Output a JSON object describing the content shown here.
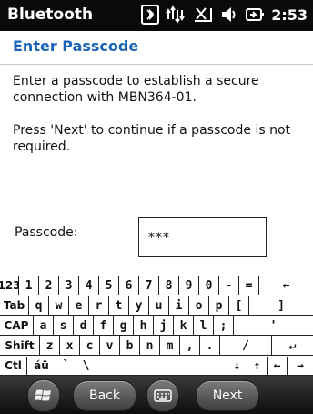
{
  "statusbar": {
    "title": "Bluetooth",
    "time": "2:53",
    "icons": [
      "bluetooth-icon",
      "connectivity-arrows-icon",
      "signal-off-icon",
      "speaker-icon",
      "battery-icon"
    ]
  },
  "header": {
    "title": "Enter Passcode"
  },
  "content": {
    "line1": "Enter a passcode to establish a secure connection with MBN364-01.",
    "line2": "Press 'Next' to continue if a passcode is not required."
  },
  "passcode": {
    "label": "Passcode:",
    "value": "***"
  },
  "keyboard": {
    "rows": [
      [
        "123",
        "1",
        "2",
        "3",
        "4",
        "5",
        "6",
        "7",
        "8",
        "9",
        "0",
        "-",
        "=",
        "←"
      ],
      [
        "Tab",
        "q",
        "w",
        "e",
        "r",
        "t",
        "y",
        "u",
        "i",
        "o",
        "p",
        "[",
        "]"
      ],
      [
        "CAP",
        "a",
        "s",
        "d",
        "f",
        "g",
        "h",
        "j",
        "k",
        "l",
        ";",
        "'"
      ],
      [
        "Shift",
        "z",
        "x",
        "c",
        "v",
        "b",
        "n",
        "m",
        ",",
        ".",
        "/",
        "↵"
      ],
      [
        "Ctl",
        "áü",
        "`",
        "\\",
        " ",
        "↓",
        "↑",
        "←",
        "→"
      ]
    ]
  },
  "softkeys": {
    "back": "Back",
    "next": "Next"
  }
}
